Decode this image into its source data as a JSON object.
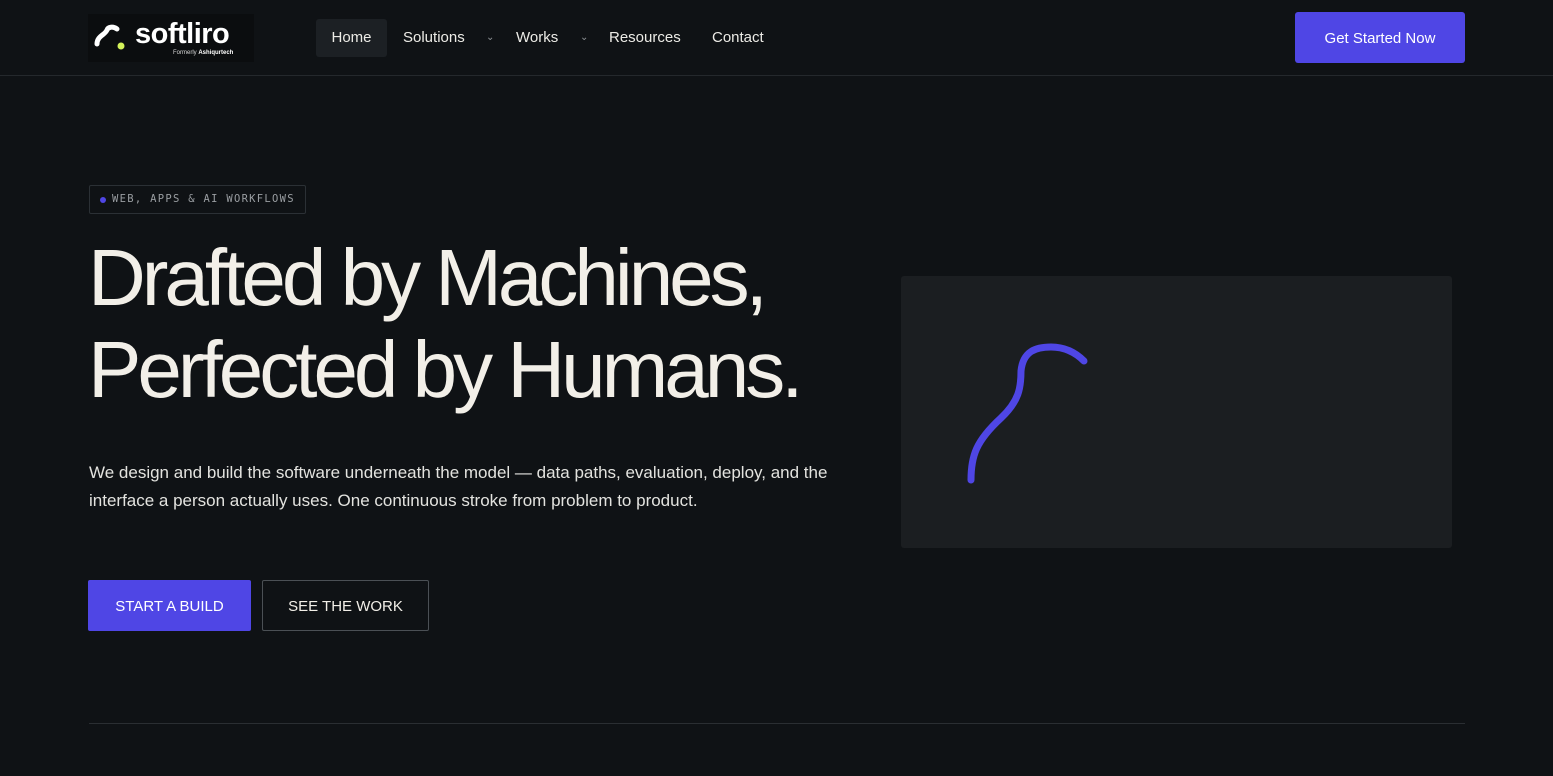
{
  "brand": {
    "name": "softliro",
    "sub_prefix": "Formerly",
    "sub_name": "Ashiqurtech",
    "accent": "#4f46e5",
    "mark_dot_color": "#d4f25a"
  },
  "nav": {
    "items": [
      {
        "label": "Home",
        "active": true
      },
      {
        "label": "Solutions",
        "has_dropdown": true
      },
      {
        "label": "Works",
        "has_dropdown": true
      },
      {
        "label": "Resources"
      },
      {
        "label": "Contact"
      }
    ],
    "cta_label": "Get Started Now"
  },
  "hero": {
    "tag": "WEB, APPS & AI WORKFLOWS",
    "headline_line1": "Drafted by Machines,",
    "headline_line2": "Perfected by Humans.",
    "description": "We design and build the software underneath the model — data paths, evaluation, deploy, and the interface a person actually uses. One continuous stroke from problem to product.",
    "primary_button": "START A BUILD",
    "secondary_button": "SEE THE WORK"
  },
  "colors": {
    "background": "#0f1215",
    "panel": "#1b1e21",
    "text": "#f2efe8"
  }
}
